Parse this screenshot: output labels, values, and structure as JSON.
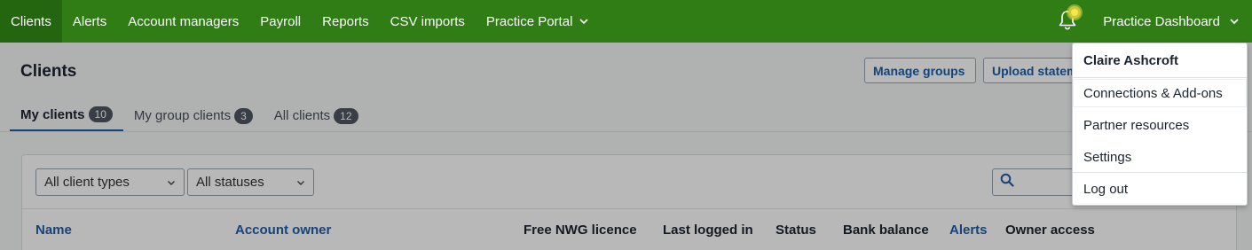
{
  "topnav": {
    "items": [
      {
        "label": "Clients",
        "active": true
      },
      {
        "label": "Alerts"
      },
      {
        "label": "Account managers"
      },
      {
        "label": "Payroll"
      },
      {
        "label": "Reports"
      },
      {
        "label": "CSV imports"
      },
      {
        "label": "Practice Portal",
        "dropdown": true
      }
    ],
    "practice_dashboard_label": "Practice Dashboard"
  },
  "page": {
    "title": "Clients",
    "buttons": {
      "manage_groups": "Manage groups",
      "upload_statements": "Upload statements"
    },
    "tabs": [
      {
        "label": "My clients",
        "count": "10",
        "active": true
      },
      {
        "label": "My group clients",
        "count": "3"
      },
      {
        "label": "All clients",
        "count": "12"
      }
    ],
    "filters": {
      "client_types": "All client types",
      "statuses": "All statuses"
    },
    "columns": {
      "name": "Name",
      "account_owner": "Account owner",
      "free_nwg_licence": "Free NWG licence",
      "last_logged_in": "Last logged in",
      "status": "Status",
      "bank_balance": "Bank balance",
      "alerts": "Alerts",
      "owner_access": "Owner access"
    }
  },
  "user_menu": {
    "user_name": "Claire Ashcroft",
    "items": [
      "Connections & Add-ons",
      "Partner resources",
      "Settings",
      "Log out"
    ]
  },
  "colors": {
    "nav_green": "#2f7d14",
    "link_blue": "#1f5da8"
  }
}
